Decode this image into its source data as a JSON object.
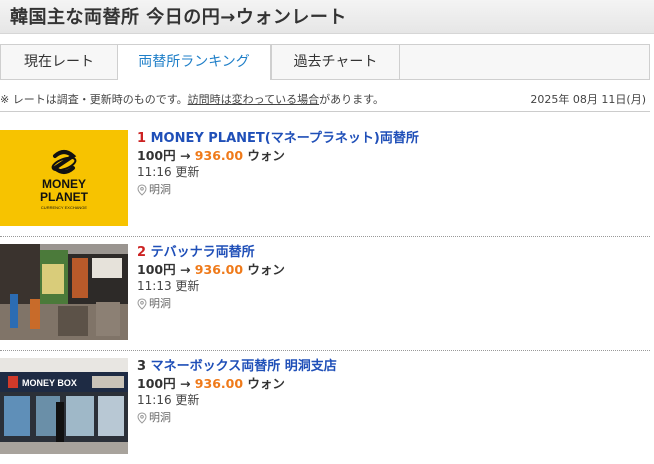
{
  "header": {
    "title": "韓国主な両替所 今日の円→ウォンレート"
  },
  "tabs": [
    {
      "label": "現在レート"
    },
    {
      "label": "両替所ランキング"
    },
    {
      "label": "過去チャート"
    }
  ],
  "notice": {
    "prefix": "※ レートは調査・更新時のものです。",
    "link_text": "訪問時は変わっている場合",
    "suffix": "があります。",
    "date": "2025年 08月 11日(月)"
  },
  "items": [
    {
      "rank": "1",
      "name": "MONEY PLANET(マネープラネット)両替所",
      "amount_yen": "100円",
      "arrow": "→",
      "rate": "936.00",
      "unit": "ウォン",
      "time": "11:16",
      "updated": "更新",
      "location": "明洞",
      "logo_text_1": "MONEY",
      "logo_text_2": "PLANET",
      "logo_text_3": "CURRENCY EXCHANGE"
    },
    {
      "rank": "2",
      "name": "テバッナラ両替所",
      "amount_yen": "100円",
      "arrow": "→",
      "rate": "936.00",
      "unit": "ウォン",
      "time": "11:13",
      "updated": "更新",
      "location": "明洞"
    },
    {
      "rank": "3",
      "name": "マネーボックス両替所 明洞支店",
      "amount_yen": "100円",
      "arrow": "→",
      "rate": "936.00",
      "unit": "ウォン",
      "time": "11:16",
      "updated": "更新",
      "location": "明洞",
      "sign_text": "MONEY BOX"
    }
  ],
  "colors": {
    "accent": "#1f7fc8",
    "rank_red": "#cc2222",
    "name_blue": "#1f4fb8",
    "rate_orange": "#ef7a1a",
    "logo_yellow": "#f7c300"
  },
  "icons": {
    "location": "map-pin-icon"
  }
}
